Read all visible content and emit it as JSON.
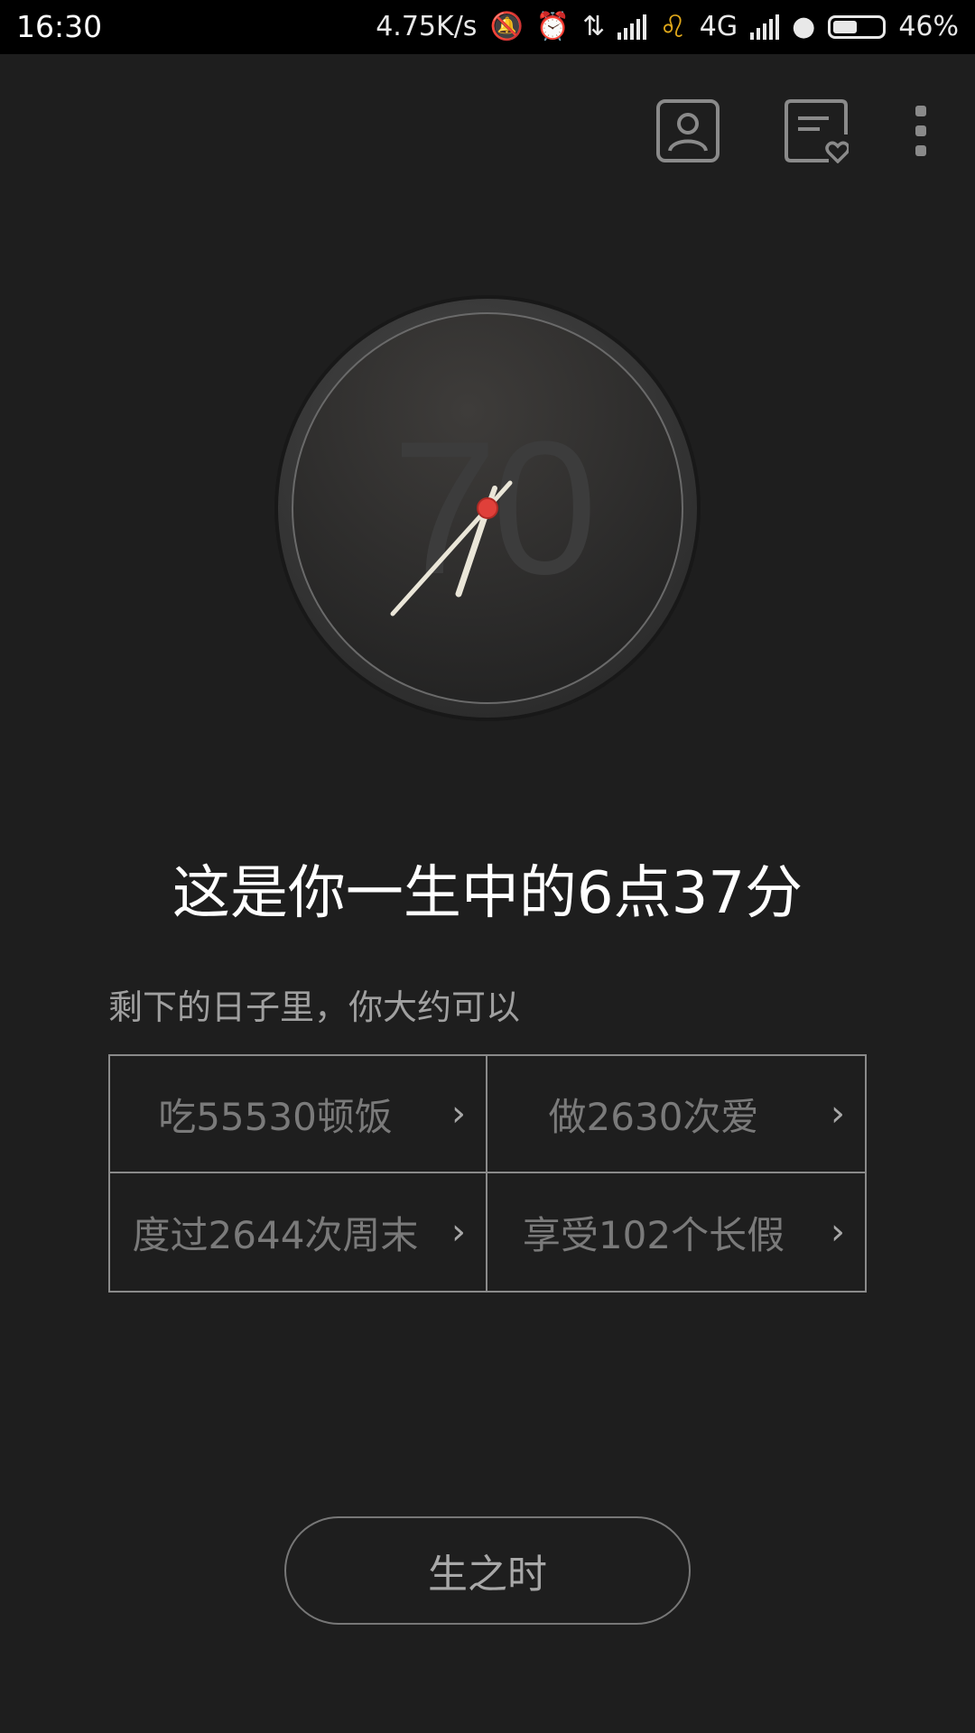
{
  "status_bar": {
    "time": "16:30",
    "net_speed": "4.75K/s",
    "network": "4G",
    "battery": "46%",
    "icons": [
      "mute-bell-icon",
      "alarm-icon",
      "data-arrows-icon",
      "signal-icon",
      "leo-icon",
      "signal-icon",
      "notification-icon",
      "battery-icon"
    ]
  },
  "actions": {
    "profile_icon": "profile-icon",
    "favorites_icon": "favorites-icon",
    "more_icon": "more-icon"
  },
  "clock": {
    "age_label": "70"
  },
  "headline": "这是你一生中的6点37分",
  "subhead": "剩下的日子里，你大约可以",
  "stats": [
    {
      "label": "吃55530顿饭"
    },
    {
      "label": "做2630次爱"
    },
    {
      "label": "度过2644次周末"
    },
    {
      "label": "享受102个长假"
    }
  ],
  "chevron": "›",
  "bottom_button": "生之时",
  "colors": {
    "background": "#1e1e1e",
    "accent_red": "#e0403a"
  }
}
